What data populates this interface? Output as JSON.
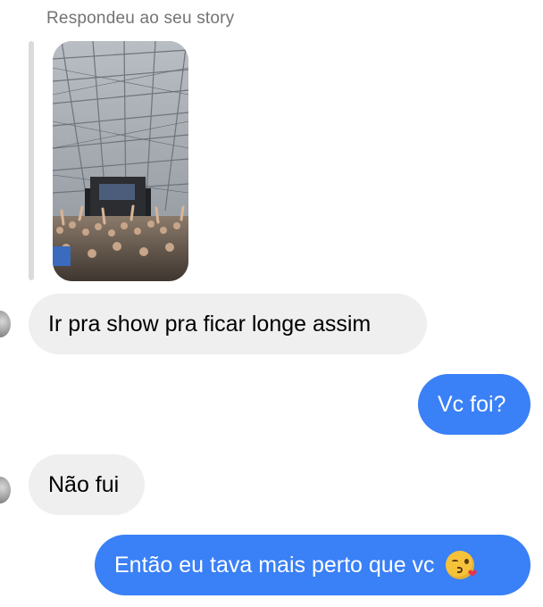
{
  "thread": {
    "reply_context": "Respondeu ao seu story",
    "messages": [
      {
        "side": "incoming",
        "text": "Ir pra show pra ficar longe assim"
      },
      {
        "side": "outgoing",
        "text": "Vc foi?"
      },
      {
        "side": "incoming",
        "text": "Não fui"
      },
      {
        "side": "outgoing",
        "text": "Então eu tava mais perto que vc",
        "emoji": "kissing-face-with-heart-emoji"
      }
    ]
  },
  "colors": {
    "outgoing_bubble": "#3a80f6",
    "incoming_bubble": "#efefef",
    "reply_header_text": "#737373"
  },
  "icons": {
    "story": "concert-story-photo",
    "avatar": "sender-avatar"
  }
}
